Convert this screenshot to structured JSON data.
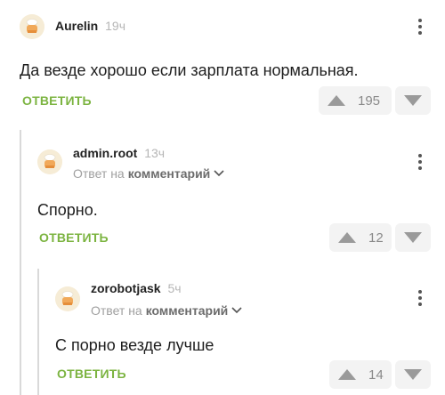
{
  "comments": [
    {
      "author": "Aurelin",
      "time": "19ч",
      "text": "Да везде хорошо если зарплата нормальная.",
      "reply_label": "ОТВЕТИТЬ",
      "votes": "195"
    },
    {
      "author": "admin.root",
      "time": "13ч",
      "reply_to_prefix": "Ответ на",
      "reply_to_link": "комментарий",
      "text": "Спорно.",
      "reply_label": "ОТВЕТИТЬ",
      "votes": "12"
    },
    {
      "author": "zorobotjask",
      "time": "5ч",
      "reply_to_prefix": "Ответ на",
      "reply_to_link": "комментарий",
      "text": "С порно везде лучше",
      "reply_label": "ОТВЕТИТЬ",
      "votes": "14"
    }
  ],
  "colors": {
    "accent": "#7cb441",
    "muted": "#a0a0a0",
    "vote_bg": "#f3f3f3"
  },
  "icons": [
    "avatar-chef",
    "kebab-icon",
    "chevron-down-icon",
    "upvote-icon",
    "downvote-icon"
  ]
}
